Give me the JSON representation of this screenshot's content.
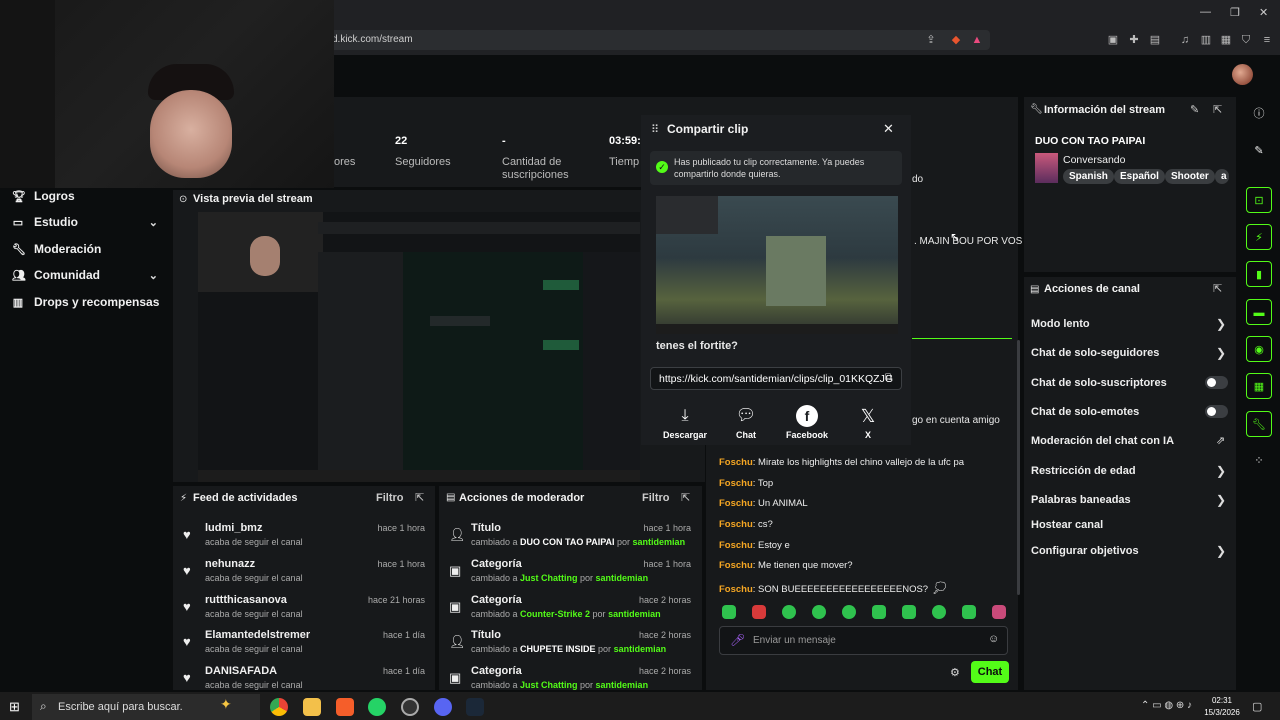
{
  "browser": {
    "url": "d.kick.com/stream"
  },
  "nav": {
    "items": [
      {
        "label": "Logros"
      },
      {
        "label": "Estudio"
      },
      {
        "label": "Moderación"
      },
      {
        "label": "Comunidad"
      },
      {
        "label": "Drops y recompensas"
      }
    ]
  },
  "stats": [
    {
      "value": "",
      "label": "ores"
    },
    {
      "value": "22",
      "label": "Seguidores"
    },
    {
      "value": "-",
      "label": "Cantidad de\nsuscripciones"
    },
    {
      "value": "03:59:",
      "label": "Tiemp"
    }
  ],
  "preview": {
    "title": "Vista previa del stream"
  },
  "feed": {
    "title": "Feed de actividades",
    "filter": "Filtro",
    "rows": [
      {
        "name": "ludmi_bmz",
        "sub": "acaba de seguir el canal",
        "time": "hace 1 hora"
      },
      {
        "name": "nehunazz",
        "sub": "acaba de seguir el canal",
        "time": "hace 1 hora"
      },
      {
        "name": "ruttthicasanova",
        "sub": "acaba de seguir el canal",
        "time": "hace 21 horas"
      },
      {
        "name": "Elamantedelstremer",
        "sub": "acaba de seguir el canal",
        "time": "hace 1 día"
      },
      {
        "name": "DANISAFADA",
        "sub": "acaba de seguir el canal",
        "time": "hace 1 día"
      }
    ]
  },
  "modactions": {
    "title": "Acciones de moderador",
    "filter": "Filtro",
    "rows": [
      {
        "title": "Título",
        "pre": "cambiado a ",
        "value": "DUO CON TAO PAIPAI",
        "by": " por ",
        "user": "santidemian",
        "time": "hace 1 hora"
      },
      {
        "title": "Categoría",
        "pre": "cambiado a ",
        "value": "Just Chatting",
        "by": " por ",
        "user": "santidemian",
        "time": "hace 1 hora"
      },
      {
        "title": "Categoría",
        "pre": "cambiado a ",
        "value": "Counter-Strike 2",
        "by": " por ",
        "user": "santidemian",
        "time": "hace 2 horas"
      },
      {
        "title": "Título",
        "pre": "cambiado a ",
        "value": "CHUPETE INSIDE",
        "by": " por ",
        "user": "santidemian",
        "time": "hace 2 horas"
      },
      {
        "title": "Categoría",
        "pre": "cambiado a ",
        "value": "Just Chatting",
        "by": " por ",
        "user": "santidemian",
        "time": "hace 2 horas"
      }
    ]
  },
  "clip": {
    "title": "Compartir clip",
    "success": "Has publicado tu clip correctamente. Ya puedes compartirlo donde quieras.",
    "caption": "tenes el fortite?",
    "link": "https://kick.com/santidemian/clips/clip_01KKQZJG",
    "share": [
      {
        "label": "Descargar",
        "icon": "download-icon"
      },
      {
        "label": "Chat",
        "icon": "chat-icon"
      },
      {
        "label": "Facebook",
        "icon": "facebook-icon"
      },
      {
        "label": "X",
        "icon": "x-icon"
      }
    ]
  },
  "chat": {
    "partial": [
      "do",
      ". MAJIN BOU POR VOS",
      "go en cuenta amigo"
    ],
    "messages": [
      {
        "user": "Foschu",
        "text": ": Mirate los highlights del chino vallejo de la ufc pa"
      },
      {
        "user": "Foschu",
        "text": ": Top"
      },
      {
        "user": "Foschu",
        "text": ": Un ANIMAL"
      },
      {
        "user": "Foschu",
        "text": ": cs?"
      },
      {
        "user": "Foschu",
        "text": ": Estoy e"
      },
      {
        "user": "Foschu",
        "text": ": Me tienen que mover?"
      },
      {
        "user": "Foschu",
        "text": ": SON BUEEEEEEEEEEEEEEEEENOS?"
      }
    ],
    "input_placeholder": "Enviar un mensaje",
    "send": "Chat"
  },
  "streaminfo": {
    "title": "Información del stream",
    "stream_title": "DUO CON TAO PAIPAI",
    "category": "Conversando",
    "tags": [
      "Spanish",
      "Español",
      "Shooter",
      "a"
    ]
  },
  "channel": {
    "title": "Acciones de canal",
    "actions": [
      {
        "label": "Modo lento",
        "control": "chevron"
      },
      {
        "label": "Chat de solo-seguidores",
        "control": "chevron"
      },
      {
        "label": "Chat de solo-suscriptores",
        "control": "toggle"
      },
      {
        "label": "Chat de solo-emotes",
        "control": "toggle"
      },
      {
        "label": "Moderación del chat con IA",
        "control": "external"
      },
      {
        "label": "Restricción de edad",
        "control": "chevron"
      },
      {
        "label": "Palabras baneadas",
        "control": "chevron"
      },
      {
        "label": "Hostear canal",
        "control": "none"
      },
      {
        "label": "Configurar objetivos",
        "control": "chevron"
      }
    ]
  },
  "taskbar": {
    "search_placeholder": "Escribe aquí para buscar.",
    "time": "02:31",
    "date": "15/3/2026"
  },
  "colors": {
    "accent": "#53fc18",
    "username": "#f5a623"
  }
}
